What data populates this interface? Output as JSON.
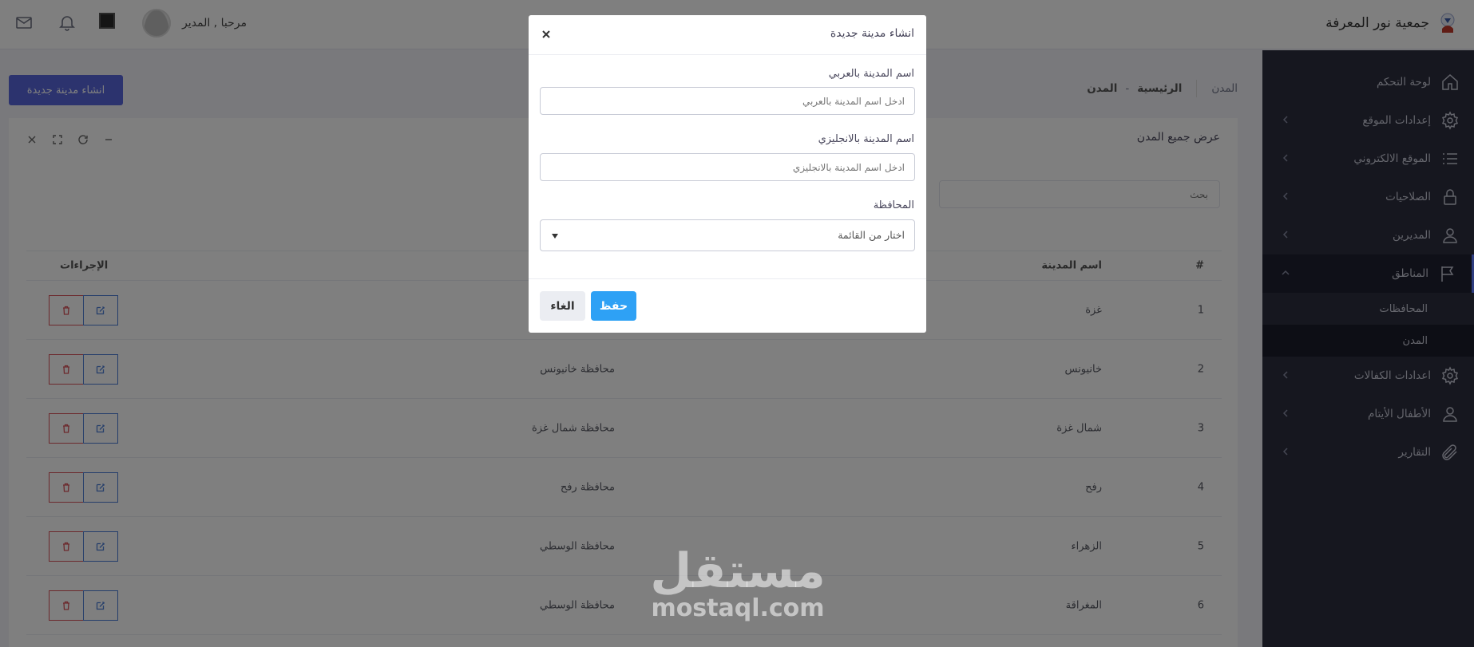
{
  "header": {
    "brand_name": "جمعية نور المعرفة",
    "greeting": "مرحبا , المدير"
  },
  "sidebar": {
    "items": [
      {
        "label": "لوحة التحكم",
        "icon": "home-icon",
        "chevron": false
      },
      {
        "label": "إعدادات الموقع",
        "icon": "gear-icon",
        "chevron": true
      },
      {
        "label": "الموقع الالكتروني",
        "icon": "list-icon",
        "chevron": true
      },
      {
        "label": "الصلاحيات",
        "icon": "lock-icon",
        "chevron": true
      },
      {
        "label": "المديرين",
        "icon": "user-icon",
        "chevron": true
      },
      {
        "label": "المناطق",
        "icon": "flag-icon",
        "chevron": true,
        "open": true
      },
      {
        "label": "اعدادات الكفالات",
        "icon": "gear-icon",
        "chevron": true
      },
      {
        "label": "الأطفال الأيتام",
        "icon": "user-icon",
        "chevron": true
      },
      {
        "label": "التقارير",
        "icon": "paperclip-icon",
        "chevron": true
      }
    ],
    "subitems": [
      {
        "label": "المحافظات",
        "active": false
      },
      {
        "label": "المدن",
        "active": true
      }
    ]
  },
  "breadcrumb": {
    "section": "المدن",
    "home": "الرئيسية",
    "dash": "-",
    "current": "المدن"
  },
  "actions": {
    "create_city": "انشاء مدينة جديدة"
  },
  "panel": {
    "title": "عرض جميع المدن",
    "search_placeholder": "بحث"
  },
  "table": {
    "headers": {
      "num": "#",
      "city": "اسم المدينة",
      "actions": "الإجراءات"
    },
    "rows": [
      {
        "num": "1",
        "city": "غزة",
        "gov": ""
      },
      {
        "num": "2",
        "city": "خانيونس",
        "gov": "محافظة خانيونس"
      },
      {
        "num": "3",
        "city": "شمال غزة",
        "gov": "محافظة شمال غزة"
      },
      {
        "num": "4",
        "city": "رفح",
        "gov": "محافظة رفح"
      },
      {
        "num": "5",
        "city": "الزهراء",
        "gov": "محافظة الوسطي"
      },
      {
        "num": "6",
        "city": "المغراقة",
        "gov": "محافظة الوسطي"
      }
    ]
  },
  "modal": {
    "title": "انشاء مدينة جديدة",
    "name_ar_label": "اسم المدينة بالعربي",
    "name_ar_placeholder": "ادخل اسم المدينة بالعربي",
    "name_en_label": "اسم المدينة بالانجليزي",
    "name_en_placeholder": "ادخل اسم المدينة بالانجليزي",
    "gov_label": "المحافظة",
    "gov_select": "اختار من القائمة",
    "save": "حفظ",
    "cancel": "الغاء"
  },
  "watermark": {
    "arabic": "مستقل",
    "latin": "mostaql.com"
  },
  "colors": {
    "primary": "#5867dd",
    "save": "#2ea1f5",
    "sidebar": "#2c2e3e",
    "danger": "#d9535b",
    "info": "#4a7dd6"
  }
}
